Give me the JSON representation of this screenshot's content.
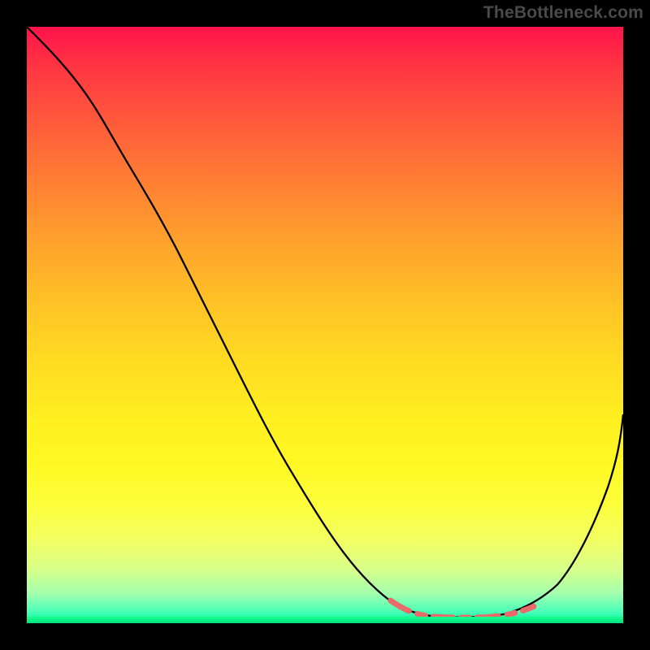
{
  "watermark": "TheBottleneck.com",
  "colors": {
    "page_bg": "#000000",
    "curve": "#000000",
    "dash": "#e86a6a",
    "gradient_top": "#ff134b",
    "gradient_bottom": "#00f59d"
  },
  "chart_data": {
    "type": "line",
    "title": "",
    "xlabel": "",
    "ylabel": "",
    "xlim": [
      0,
      100
    ],
    "ylim": [
      0,
      100
    ],
    "grid": false,
    "series": [
      {
        "name": "bottleneck-curve",
        "x": [
          0,
          4,
          8,
          12,
          16,
          20,
          24,
          28,
          32,
          36,
          40,
          44,
          48,
          52,
          56,
          60,
          64,
          68,
          72,
          76,
          80,
          84,
          88,
          92,
          96,
          100
        ],
        "y": [
          100,
          96,
          92,
          87,
          82,
          76,
          70,
          63,
          56,
          49,
          42,
          35,
          28,
          21,
          14,
          8,
          4,
          2,
          1,
          1,
          1,
          2,
          5,
          12,
          22,
          35
        ]
      }
    ],
    "annotations": [
      {
        "name": "optimal-band",
        "x_start": 62,
        "x_end": 85,
        "y": 2,
        "style": "salmon-dashed"
      }
    ]
  }
}
